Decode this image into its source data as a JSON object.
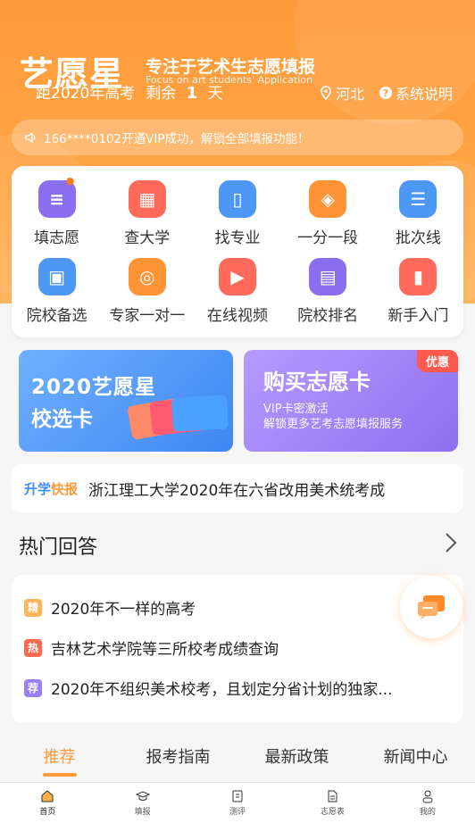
{
  "header": {
    "logo": "艺愿星",
    "slogan": "专注于艺术生志愿填报",
    "slogan_en": "Focus on art students' Application",
    "countdown_prefix": "距2020年高考",
    "countdown_remaining": "剩余",
    "countdown_days": "1",
    "countdown_unit": "天",
    "location": "河北",
    "help": "系统说明"
  },
  "notice": {
    "text": "166****0102开通VIP成功，解锁全部填报功能！"
  },
  "grid": {
    "items": [
      {
        "label": "填志愿",
        "icon": "clipboard-icon",
        "color": "#8a6ef0"
      },
      {
        "label": "查大学",
        "icon": "building-icon",
        "color": "#ff6a5a"
      },
      {
        "label": "找专业",
        "icon": "book-icon",
        "color": "#4d98f5"
      },
      {
        "label": "一分一段",
        "icon": "layers-icon",
        "color": "#ff9437"
      },
      {
        "label": "批次线",
        "icon": "list-icon",
        "color": "#4d98f5"
      },
      {
        "label": "院校备选",
        "icon": "bag-icon",
        "color": "#4d98f5"
      },
      {
        "label": "专家一对一",
        "icon": "headset-icon",
        "color": "#ff9437"
      },
      {
        "label": "在线视频",
        "icon": "video-icon",
        "color": "#ff6a5a"
      },
      {
        "label": "院校排名",
        "icon": "person-card-icon",
        "color": "#8a6ef0"
      },
      {
        "label": "新手入门",
        "icon": "phone-icon",
        "color": "#ff6a5a"
      }
    ]
  },
  "banners": {
    "left": {
      "line1": "2020艺愿星",
      "line2": "校选卡"
    },
    "right": {
      "title": "购买志愿卡",
      "line1": "VIP卡密激活",
      "line2": "解锁更多艺考志愿填报服务",
      "promo": "优惠"
    }
  },
  "news": {
    "tag_a": "升学",
    "tag_b": "快报",
    "text": "浙江理工大学2020年在六省改用美术统考成"
  },
  "hot": {
    "title": "热门回答",
    "items": [
      {
        "badge": "精",
        "badge_color": "#ffb45a",
        "text": "2020年不一样的高考"
      },
      {
        "badge": "热",
        "badge_color": "#ff6a4f",
        "text": "吉林艺术学院等三所校考成绩查询"
      },
      {
        "badge": "荐",
        "badge_color": "#9a7ef5",
        "text": "2020年不组织美术校考，且划定分省计划的独家..."
      }
    ]
  },
  "tabs": [
    "推荐",
    "报考指南",
    "最新政策",
    "新闻中心"
  ],
  "bottom_nav": [
    {
      "label": "首页",
      "icon": "home-icon"
    },
    {
      "label": "填报",
      "icon": "graduation-cap-icon"
    },
    {
      "label": "测评",
      "icon": "document-icon"
    },
    {
      "label": "志愿表",
      "icon": "form-icon"
    },
    {
      "label": "我的",
      "icon": "user-icon"
    }
  ],
  "colors": {
    "brand": "#ff9a3a",
    "accent_blue": "#3b8cf5"
  }
}
